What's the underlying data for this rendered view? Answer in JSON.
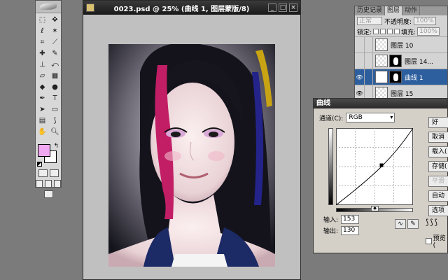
{
  "document": {
    "title": "0023.psd @ 25% (曲线 1, 图层蒙版/8)"
  },
  "toolbox": {
    "tools": [
      "marquee",
      "move",
      "lasso",
      "magic-wand",
      "crop",
      "slice",
      "healing",
      "brush",
      "stamp",
      "history-brush",
      "eraser",
      "gradient",
      "blur",
      "dodge",
      "pen",
      "type",
      "path-select",
      "shape",
      "notes",
      "eyedropper",
      "hand",
      "zoom"
    ],
    "foreground_color": "#f0a8f0",
    "background_color": "#ffffff"
  },
  "layers_panel": {
    "tabs": [
      "历史记录",
      "图层",
      "动作"
    ],
    "active_tab": "图层",
    "blend_mode": "正常",
    "opacity_label": "不透明度:",
    "opacity_value": "100%",
    "lock_label": "锁定:",
    "fill_label": "填充:",
    "fill_value": "100%",
    "layers": [
      {
        "name": "图层 10",
        "visible": false,
        "selected": false,
        "has_mask": false
      },
      {
        "name": "图层 14...",
        "visible": false,
        "selected": false,
        "has_mask": true
      },
      {
        "name": "曲线 1",
        "visible": true,
        "selected": true,
        "has_mask": true
      },
      {
        "name": "图层 15",
        "visible": true,
        "selected": false,
        "has_mask": false
      }
    ]
  },
  "curves_dialog": {
    "title": "曲线",
    "channel_label": "通道(C):",
    "channel_value": "RGB",
    "input_label": "输入:",
    "input_value": "153",
    "output_label": "输出:",
    "output_value": "130",
    "buttons": [
      "好",
      "取消",
      "载入(",
      "存储(",
      "平滑",
      "自动",
      "选项"
    ],
    "preview_label": "预览("
  }
}
